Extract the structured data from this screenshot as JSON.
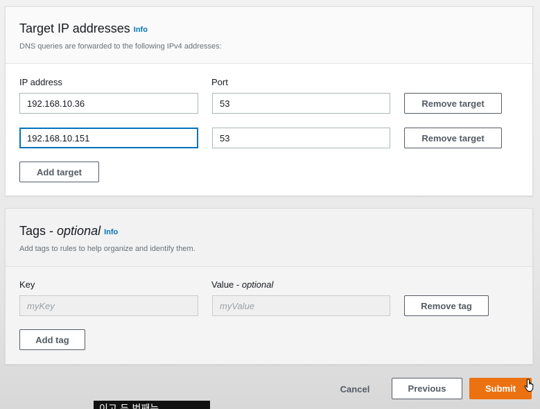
{
  "target_panel": {
    "title": "Target IP addresses",
    "info": "Info",
    "description": "DNS queries are forwarded to the following IPv4 addresses:",
    "ip_label": "IP address",
    "port_label": "Port",
    "rows": [
      {
        "ip": "192.168.10.36",
        "port": "53",
        "remove_label": "Remove target",
        "focused": false
      },
      {
        "ip": "192.168.10.151",
        "port": "53",
        "remove_label": "Remove target",
        "focused": true
      }
    ],
    "add_label": "Add target"
  },
  "tags_panel": {
    "title": "Tags - ",
    "title_optional": "optional",
    "info": "Info",
    "description": "Add tags to rules to help organize and identify them.",
    "key_label": "Key",
    "value_label": "Value - ",
    "value_optional": "optional",
    "key_placeholder": "myKey",
    "value_placeholder": "myValue",
    "remove_label": "Remove tag",
    "add_label": "Add tag"
  },
  "footer": {
    "cancel_label": "Cancel",
    "previous_label": "Previous",
    "submit_label": "Submit"
  },
  "caption": {
    "text": "이고 두 번째는"
  },
  "colors": {
    "primary": "#ec7211",
    "link": "#0073bb",
    "focus": "#0073bb",
    "button_border": "#545b64"
  }
}
